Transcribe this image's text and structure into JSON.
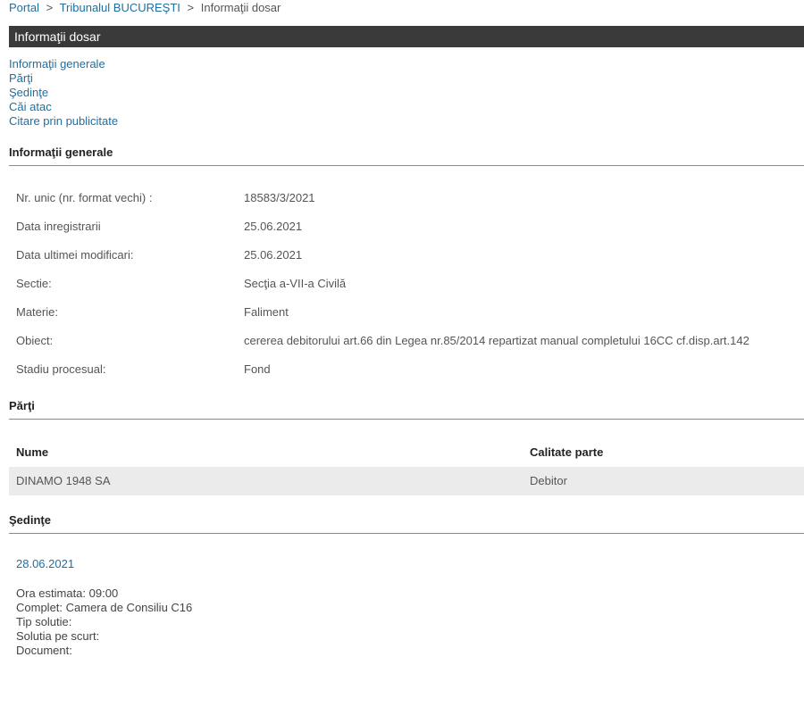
{
  "breadcrumb": {
    "portal": "Portal",
    "sep1": ">",
    "court": "Tribunalul BUCUREŞTI",
    "sep2": ">",
    "current": "Informaţii dosar"
  },
  "title_bar": "Informaţii dosar",
  "anchors": [
    "Informaţii generale",
    "Părţi",
    "Şedinţe",
    "Căi atac",
    "Citare prin publicitate"
  ],
  "general": {
    "heading": "Informaţii generale",
    "rows": [
      {
        "label": "Nr. unic (nr. format vechi) :",
        "value": "18583/3/2021"
      },
      {
        "label": "Data inregistrarii",
        "value": "25.06.2021"
      },
      {
        "label": "Data ultimei modificari:",
        "value": "25.06.2021"
      },
      {
        "label": "Sectie:",
        "value": "Secţia a-VII-a Civilă"
      },
      {
        "label": "Materie:",
        "value": "Faliment"
      },
      {
        "label": "Obiect:",
        "value": "cererea debitorului art.66 din Legea nr.85/2014 repartizat manual completului 16CC cf.disp.art.142 "
      },
      {
        "label": "Stadiu procesual:",
        "value": "Fond"
      }
    ]
  },
  "parti": {
    "heading": "Părţi",
    "columns": [
      "Nume",
      "Calitate parte"
    ],
    "rows": [
      {
        "nume": "DINAMO 1948 SA",
        "calitate": "Debitor"
      }
    ]
  },
  "sedinte": {
    "heading": "Şedinţe",
    "date": "28.06.2021",
    "details": [
      "Ora estimata: 09:00",
      "Complet: Camera de Consiliu C16",
      "Tip solutie:",
      "Solutia pe scurt:",
      "Document:"
    ]
  }
}
